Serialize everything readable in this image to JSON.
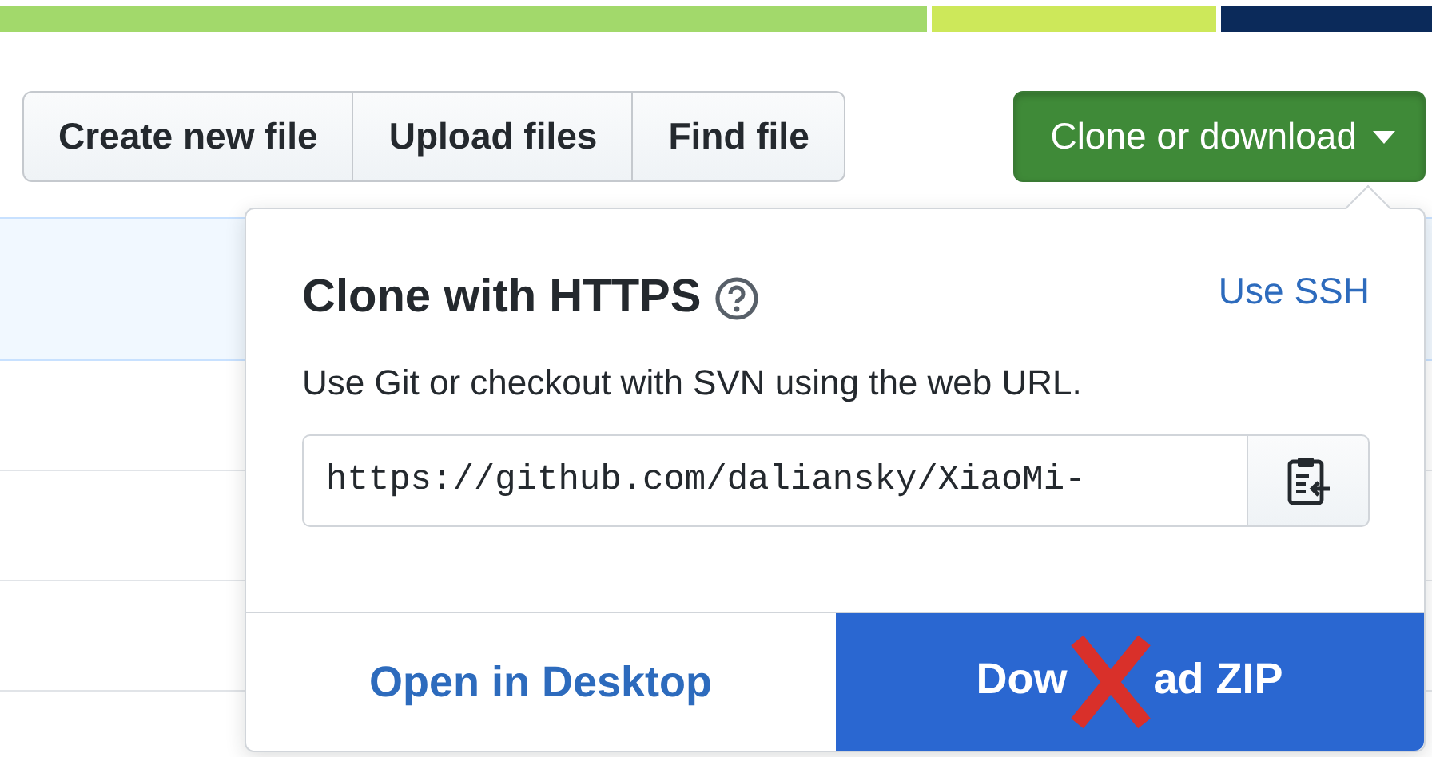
{
  "language_bar": [
    {
      "color": "#a2d96b"
    },
    {
      "color": "#cde85a"
    },
    {
      "color": "#0b2a5a"
    }
  ],
  "toolbar": {
    "buttons": [
      "Create new file",
      "Upload files",
      "Find file"
    ],
    "clone_button": {
      "label": "Clone or download",
      "expanded": true
    }
  },
  "clone_popup": {
    "title": "Clone with HTTPS",
    "alternate_link": "Use SSH",
    "description": "Use Git or checkout with SVN using the web URL.",
    "url": "https://github.com/daliansky/XiaoMi-",
    "actions": [
      {
        "label": "Open in Desktop",
        "kind": "link"
      },
      {
        "label_parts": [
          "Dow",
          "ad ZIP"
        ],
        "kind": "primary",
        "crossed_out": true
      }
    ]
  }
}
